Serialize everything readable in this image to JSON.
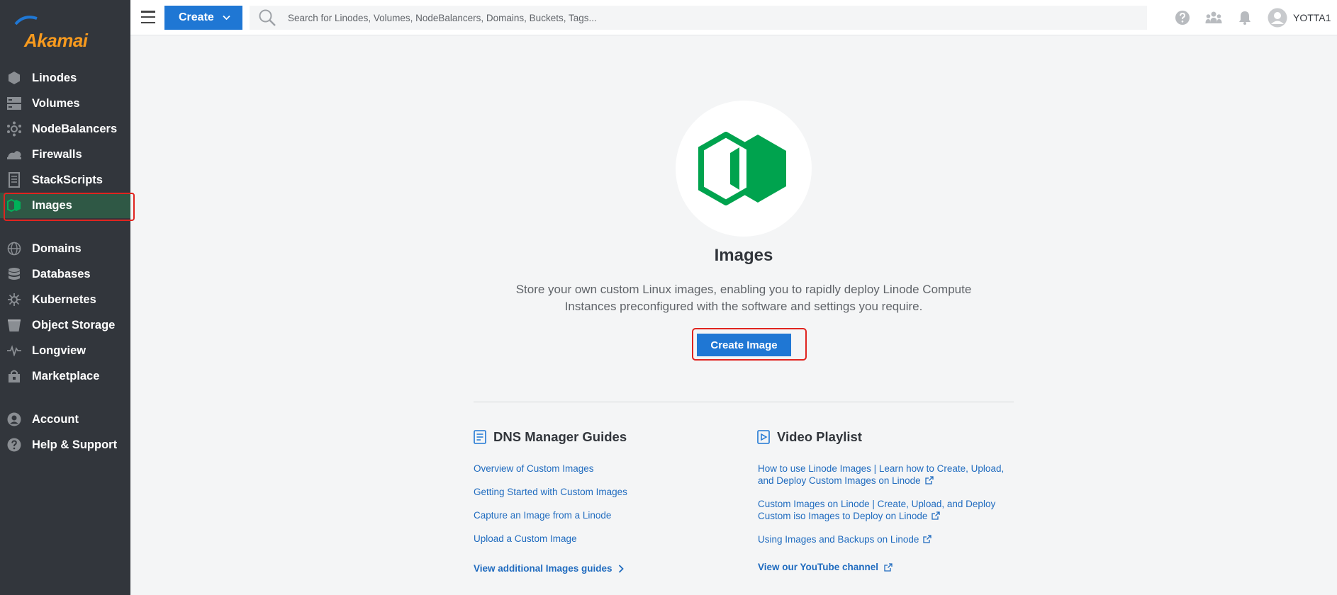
{
  "sidebar": {
    "logo_text": "Akamai",
    "items": [
      {
        "label": "Linodes",
        "icon": "linode-hex-icon"
      },
      {
        "label": "Volumes",
        "icon": "volumes-icon"
      },
      {
        "label": "NodeBalancers",
        "icon": "nodebalancer-icon"
      },
      {
        "label": "Firewalls",
        "icon": "firewall-icon"
      },
      {
        "label": "StackScripts",
        "icon": "stackscript-icon"
      },
      {
        "label": "Images",
        "icon": "images-icon",
        "active": true
      },
      {
        "label": "Domains",
        "icon": "globe-icon"
      },
      {
        "label": "Databases",
        "icon": "database-icon"
      },
      {
        "label": "Kubernetes",
        "icon": "kubernetes-icon"
      },
      {
        "label": "Object Storage",
        "icon": "bucket-icon"
      },
      {
        "label": "Longview",
        "icon": "pulse-icon"
      },
      {
        "label": "Marketplace",
        "icon": "marketplace-icon"
      },
      {
        "label": "Account",
        "icon": "account-icon"
      },
      {
        "label": "Help & Support",
        "icon": "help-icon"
      }
    ],
    "active_color": "#2f5845"
  },
  "topbar": {
    "create_label": "Create",
    "search_placeholder": "Search for Linodes, Volumes, NodeBalancers, Domains, Buckets, Tags...",
    "username": "YOTTA1"
  },
  "main": {
    "title": "Images",
    "subtitle": "Store your own custom Linux images, enabling you to rapidly deploy Linode Compute Instances preconfigured with the software and settings you require.",
    "create_button": "Create Image",
    "guides": {
      "heading": "DNS Manager Guides",
      "links": [
        "Overview of Custom Images",
        "Getting Started with Custom Images",
        "Capture an Image from a Linode",
        "Upload a Custom Image"
      ],
      "more": "View additional Images guides"
    },
    "videos": {
      "heading": "Video Playlist",
      "links": [
        "How to use Linode Images | Learn how to Create, Upload, and Deploy Custom Images on Linode",
        "Custom Images on Linode | Create, Upload, and Deploy Custom iso Images to Deploy on Linode",
        "Using Images and Backups on Linode"
      ],
      "more": "View our YouTube channel"
    }
  },
  "colors": {
    "primary": "#1f77d4",
    "brand_green": "#00a34e",
    "link": "#1f6bbf",
    "highlight": "#e0241f",
    "sidebar_bg": "#32363c"
  }
}
